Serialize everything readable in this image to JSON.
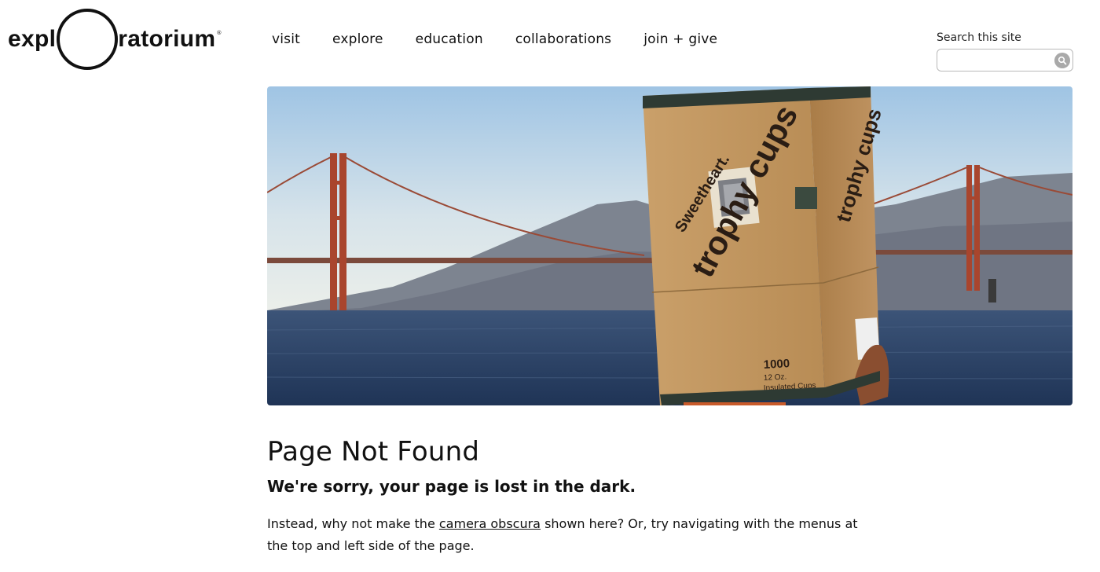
{
  "logo": {
    "left_text": "expl",
    "right_text": "ratorium",
    "reg_mark": "®"
  },
  "nav": {
    "items": [
      {
        "label": "visit"
      },
      {
        "label": "explore"
      },
      {
        "label": "education"
      },
      {
        "label": "collaborations"
      },
      {
        "label": "join + give"
      }
    ]
  },
  "search": {
    "label": "Search this site",
    "value": "",
    "placeholder": ""
  },
  "hero": {
    "box_brand": "Sweetheart.",
    "box_product": "trophy cups",
    "box_count": "1000",
    "box_size": "12 Oz.",
    "box_desc": "Insulated Cups"
  },
  "content": {
    "title": "Page Not Found",
    "subtitle": "We're sorry, your page is lost in the dark.",
    "body_before": "Instead, why not make the ",
    "body_link": "camera obscura",
    "body_after": " shown here? Or, try navigating with the menus at the top and left side of the page."
  },
  "colors": {
    "sky_top": "#a6c9e6",
    "sky_bottom": "#e5ebea",
    "water": "#2b4164",
    "bridge": "#b0462c",
    "box": "#c49a63"
  }
}
